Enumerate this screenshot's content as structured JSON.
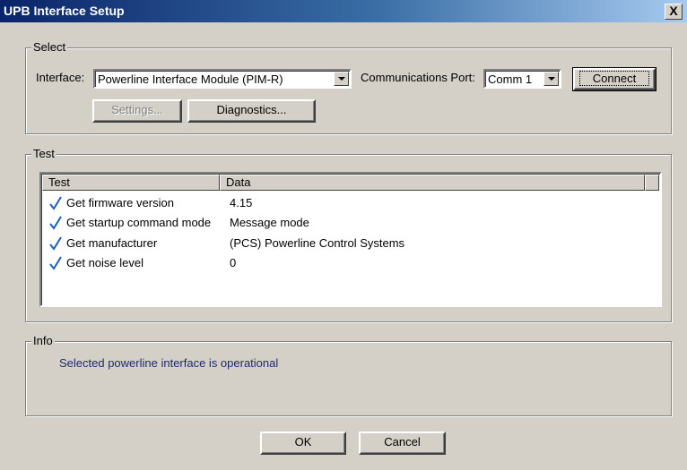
{
  "window": {
    "title": "UPB Interface Setup",
    "close_label": "X"
  },
  "select_group": {
    "legend": "Select",
    "interface_label": "Interface:",
    "interface_value": "Powerline Interface Module (PIM-R)",
    "port_label": "Communications Port:",
    "port_value": "Comm 1",
    "connect_label": "Connect",
    "settings_label": "Settings...",
    "diagnostics_label": "Diagnostics..."
  },
  "test_group": {
    "legend": "Test",
    "columns": [
      "Test",
      "Data"
    ],
    "rows": [
      {
        "test": "Get firmware version",
        "data": "4.15"
      },
      {
        "test": "Get startup command mode",
        "data": "Message mode"
      },
      {
        "test": "Get manufacturer",
        "data": "(PCS) Powerline Control Systems"
      },
      {
        "test": "Get noise level",
        "data": "0"
      }
    ]
  },
  "info_group": {
    "legend": "Info",
    "message": "Selected powerline interface is operational"
  },
  "footer": {
    "ok_label": "OK",
    "cancel_label": "Cancel"
  },
  "colors": {
    "title_bar": "#0a246a",
    "check": "#1a5fc0",
    "info_text": "#1f2a6e",
    "dialog_bg": "#d4d0c8"
  }
}
